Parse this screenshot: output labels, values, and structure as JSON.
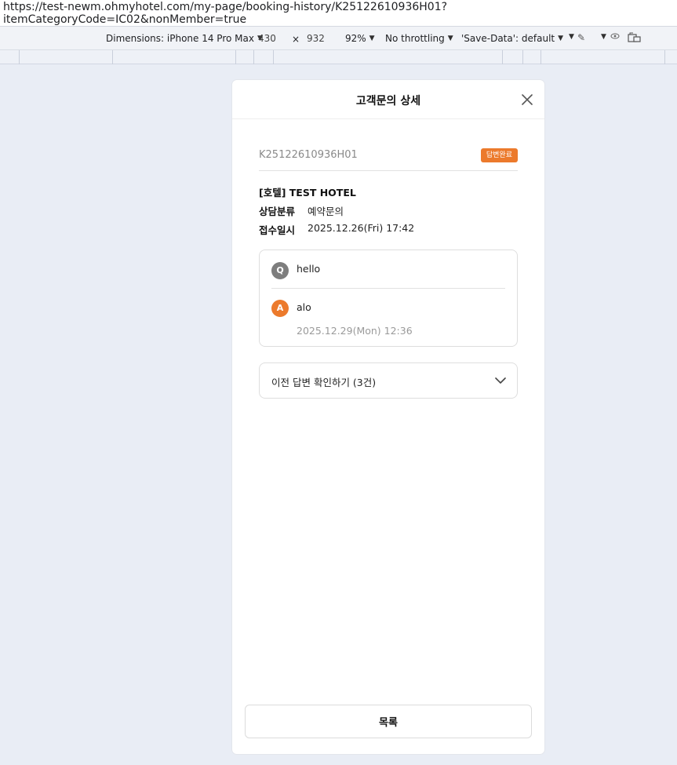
{
  "browser": {
    "url": "https://test-newm.ohmyhotel.com/my-page/booking-history/K25122610936H01?itemCategoryCode=IC02&nonMember=true"
  },
  "devtools": {
    "device": "Dimensions: iPhone 14 Pro Max",
    "width": "430",
    "times": "×",
    "height": "932",
    "zoom": "92%",
    "throttling": "No throttling",
    "save_data": "'Save-Data': default"
  },
  "modal": {
    "title": "고객문의 상세",
    "booking_number": "K25122610936H01",
    "status_badge": "답변완료",
    "hotel_name": "[호텔] TEST HOTEL",
    "category_label": "상담분류",
    "category_value": "예약문의",
    "received_label": "접수일시",
    "received_value": "2025.12.26(Fri) 17:42",
    "question": {
      "badge": "Q",
      "text": "hello"
    },
    "answer": {
      "badge": "A",
      "text": "alo",
      "date": "2025.12.29(Mon) 12:36"
    },
    "previous_answers_label": "이전 답변 확인하기 (3건)",
    "list_button_label": "목록"
  },
  "colors": {
    "accent": "#ec7a2c",
    "question_avatar": "#7d7d7d",
    "viewport_bg": "#e9edf5"
  },
  "icons": {
    "close": "close-icon",
    "chevron": "chevron-down-icon",
    "inspect": "pen-icon",
    "sensors": "eye-icon",
    "rotate": "rotate-icon"
  }
}
